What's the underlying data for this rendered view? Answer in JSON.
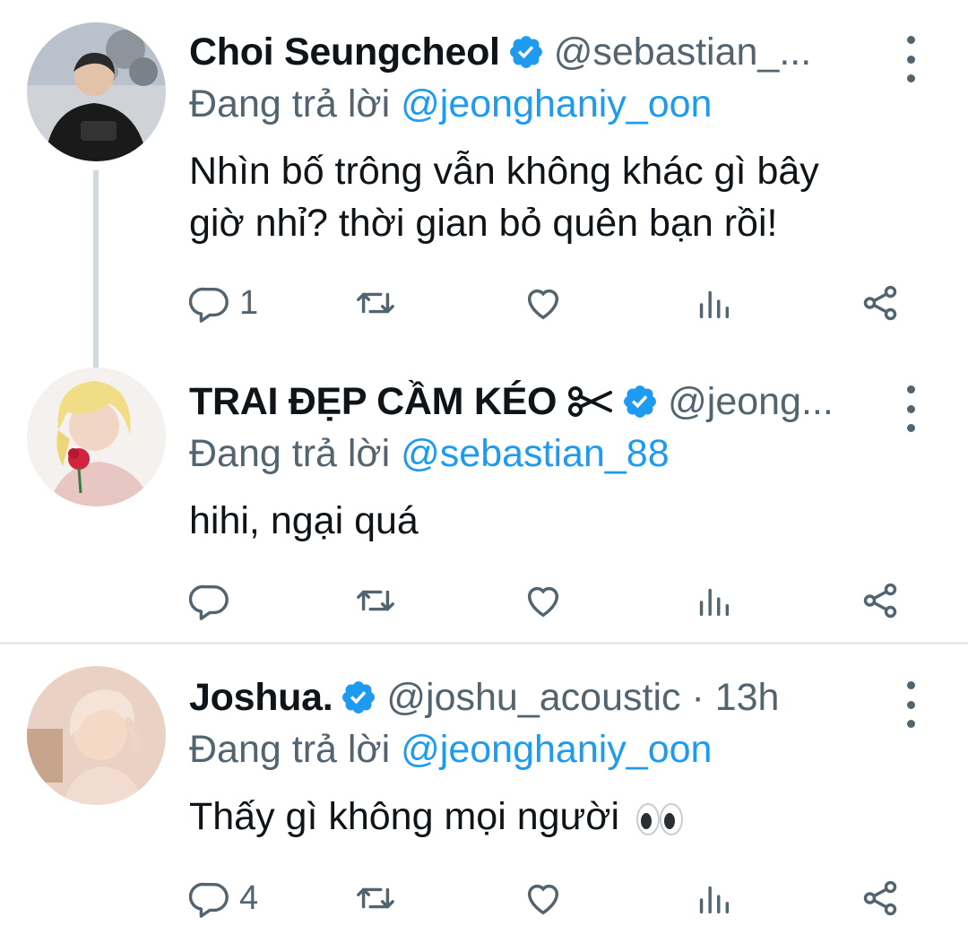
{
  "tweets": [
    {
      "name": "Choi Seungcheol",
      "handle": "@sebastian_...",
      "reply_label": "Đang trả lời",
      "reply_mention": "@jeonghaniy_oon",
      "text_lines": [
        "Nhìn bố trông vẫn không khác gì bây",
        "giờ nhỉ? thời gian bỏ quên bạn rồi!"
      ],
      "reply_count": "1",
      "verified": true
    },
    {
      "name": "TRAI ĐẸP CẦM KÉO",
      "name_emoji": "scissors-icon",
      "handle": "@jeong...",
      "reply_label": "Đang trả lời",
      "reply_mention": "@sebastian_88",
      "text_lines": [
        "hihi, ngại quá"
      ],
      "reply_count": "",
      "verified": true
    },
    {
      "name": "Joshua.",
      "handle": "@joshu_acoustic · 13h",
      "reply_label": "Đang trả lời",
      "reply_mention": "@jeonghaniy_oon",
      "text_lines": [
        "Thấy gì không mọi người"
      ],
      "text_emoji": "eyes-icon",
      "reply_count": "4",
      "verified": true
    }
  ],
  "colors": {
    "verified": "#1d9bf0",
    "mention": "#1d9bf0",
    "secondary_text": "#536471",
    "thread_line": "#cfd9de"
  }
}
